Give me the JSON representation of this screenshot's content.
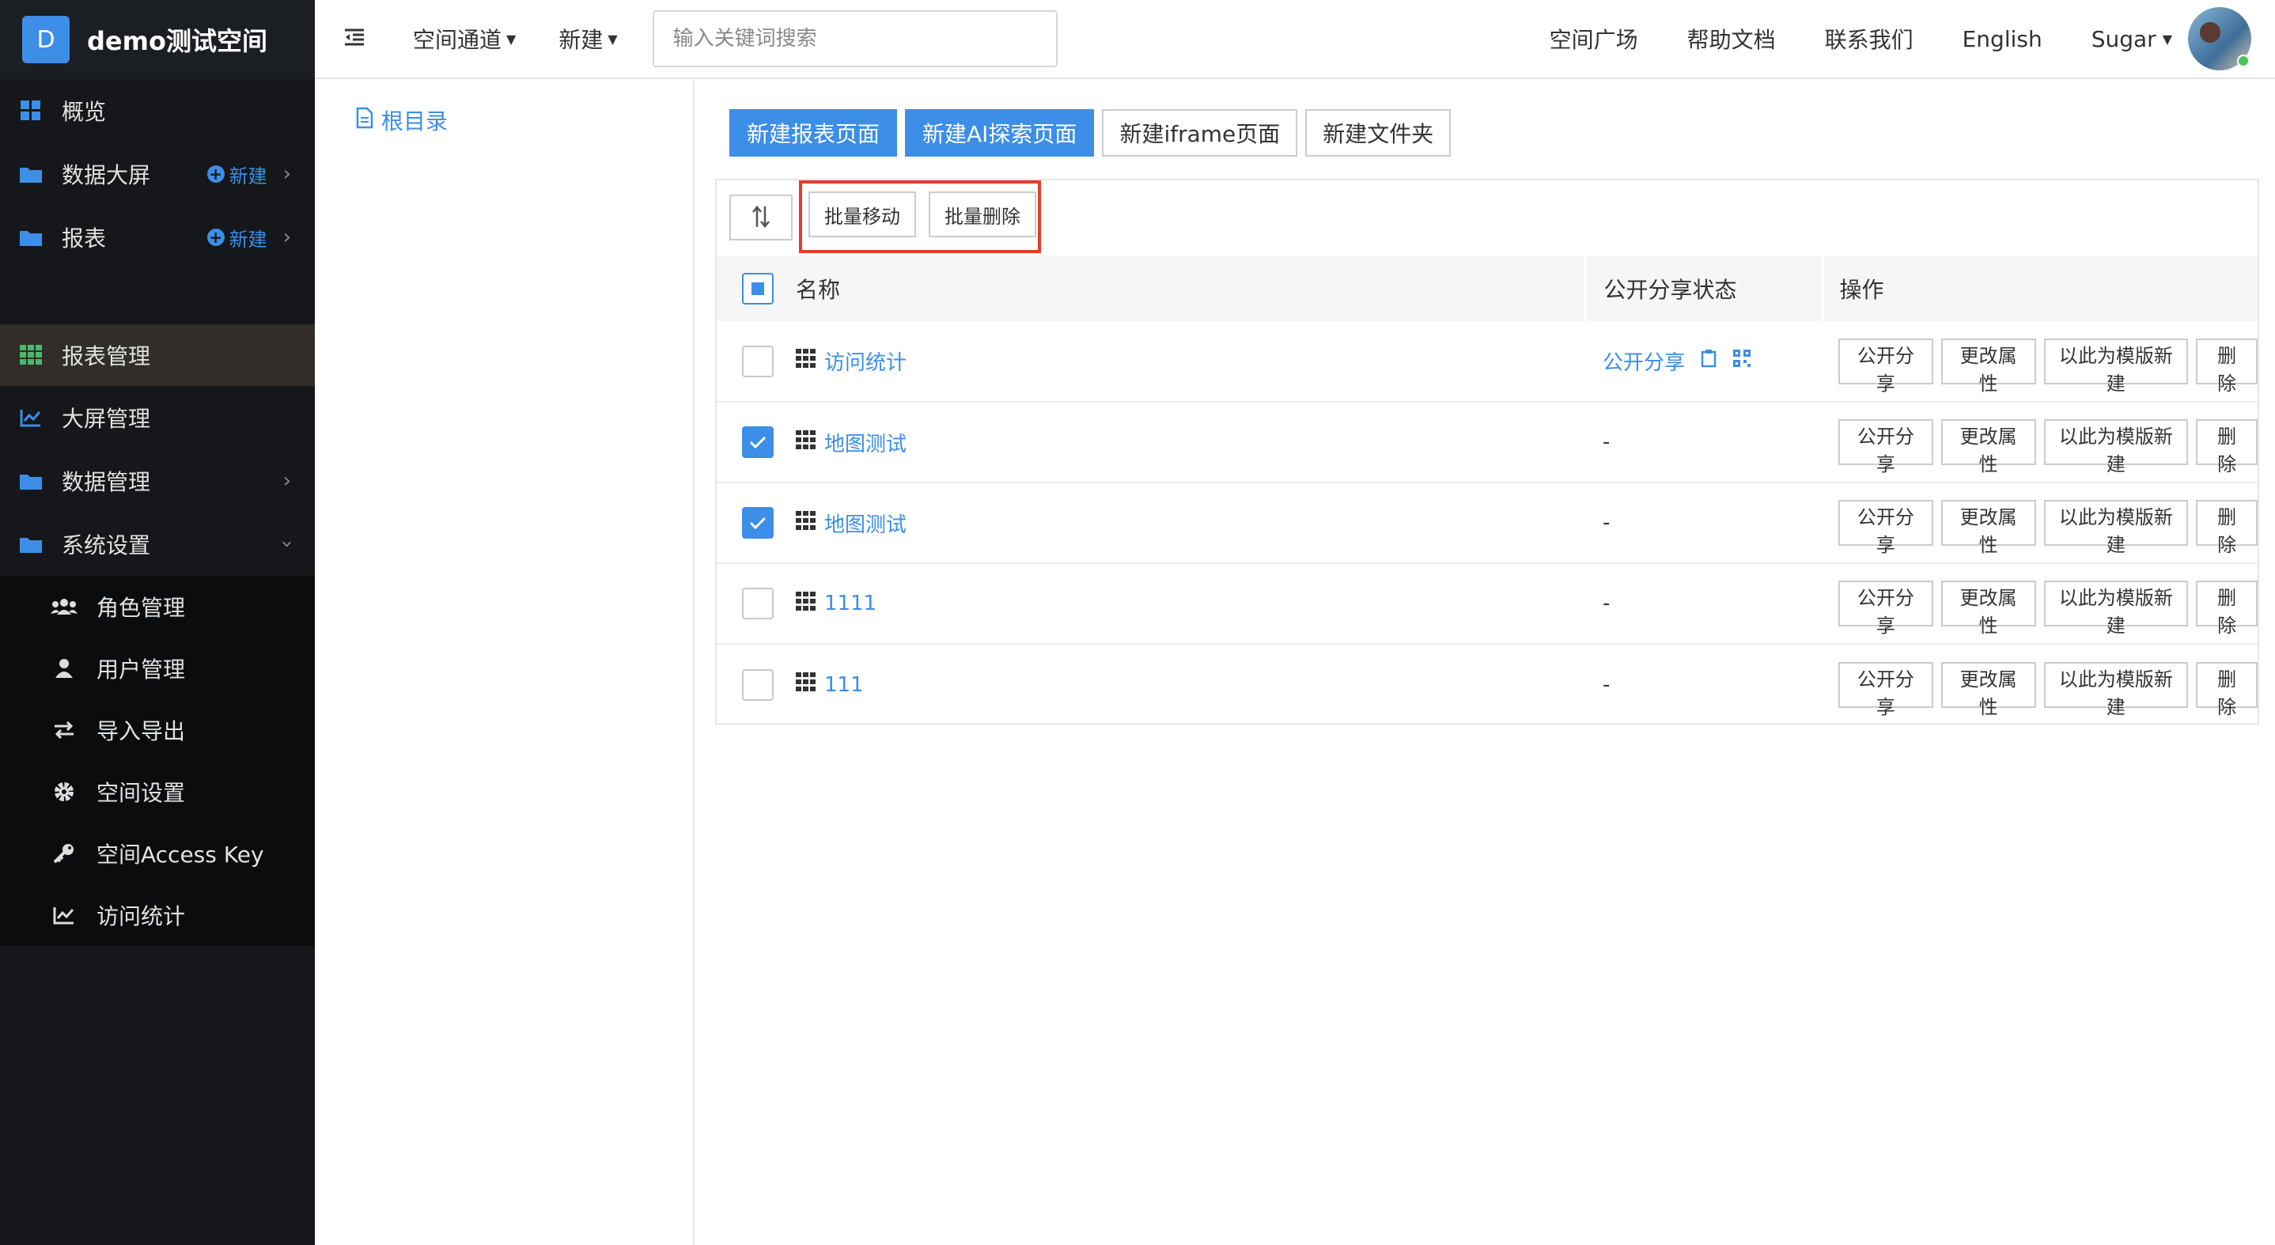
{
  "brand": {
    "logo_letter": "D",
    "title": "demo测试空间"
  },
  "sidebar": {
    "top_items": [
      {
        "label": "概览"
      },
      {
        "label": "数据大屏",
        "new_label": "新建"
      },
      {
        "label": "报表",
        "new_label": "新建"
      }
    ],
    "mgmt_items": [
      {
        "label": "报表管理"
      },
      {
        "label": "大屏管理"
      },
      {
        "label": "数据管理"
      },
      {
        "label": "系统设置"
      }
    ],
    "settings_sub": [
      {
        "label": "角色管理"
      },
      {
        "label": "用户管理"
      },
      {
        "label": "导入导出"
      },
      {
        "label": "空间设置"
      },
      {
        "label": "空间Access Key"
      },
      {
        "label": "访问统计"
      }
    ]
  },
  "header": {
    "menu_channel": "空间通道",
    "menu_new": "新建",
    "search_placeholder": "输入关键词搜索",
    "links": [
      "空间广场",
      "帮助文档",
      "联系我们",
      "English"
    ],
    "user_name": "Sugar"
  },
  "tree": {
    "root_label": "根目录"
  },
  "actions": {
    "new_report": "新建报表页面",
    "new_ai": "新建AI探索页面",
    "new_iframe": "新建iframe页面",
    "new_folder": "新建文件夹",
    "batch_move": "批量移动",
    "batch_delete": "批量删除"
  },
  "table": {
    "columns": [
      "名称",
      "公开分享状态",
      "操作"
    ],
    "share_label": "公开分享",
    "row_ops": [
      "公开分享",
      "更改属性",
      "以此为模版新建",
      "删除"
    ],
    "rows": [
      {
        "name": "访问统计",
        "share": "公开分享",
        "checked": false
      },
      {
        "name": "地图测试",
        "share": "-",
        "checked": true
      },
      {
        "name": "地图测试",
        "share": "-",
        "checked": true
      },
      {
        "name": "1111",
        "share": "-",
        "checked": false
      },
      {
        "name": "111",
        "share": "-",
        "checked": false
      }
    ]
  },
  "colors": {
    "accent": "#3c8ee6",
    "sidebar_bg": "#15171a",
    "highlight_box": "#e53d2a"
  }
}
